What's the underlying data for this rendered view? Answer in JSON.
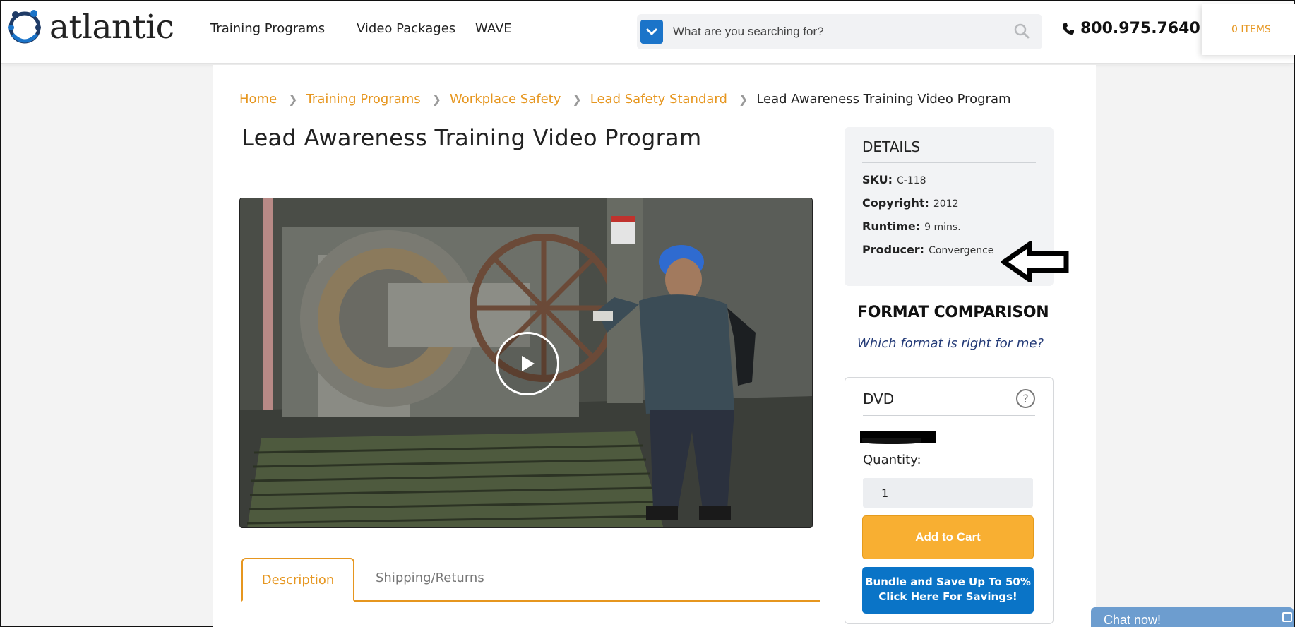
{
  "header": {
    "logo_text": "atlantic",
    "nav": [
      "Training Programs",
      "Video Packages",
      "WAVE"
    ],
    "search_placeholder": "What are you searching for?",
    "phone": "800.975.7640",
    "cart_label": "0 ITEMS"
  },
  "breadcrumb": [
    "Home",
    "Training Programs",
    "Workplace Safety",
    "Lead Safety Standard"
  ],
  "breadcrumb_current": "Lead Awareness Training Video Program",
  "page_title": "Lead Awareness Training Video Program",
  "video": {
    "play_icon": "play-icon"
  },
  "tabs": {
    "active": "Description",
    "other": "Shipping/Returns"
  },
  "details": {
    "title": "DETAILS",
    "rows": [
      {
        "label": "SKU:",
        "value": "C-118"
      },
      {
        "label": "Copyright:",
        "value": "2012"
      },
      {
        "label": "Runtime:",
        "value": "9 mins."
      },
      {
        "label": "Producer:",
        "value": "Convergence"
      }
    ]
  },
  "format": {
    "title": "FORMAT COMPARISON",
    "link": "Which format is right for me?"
  },
  "dvd": {
    "title": "DVD",
    "help": "?",
    "quantity_label": "Quantity:",
    "quantity_value": "1",
    "add_to_cart": "Add to Cart",
    "bundle_line1": "Bundle and Save Up To 50%",
    "bundle_line2": "Click Here For Savings!"
  },
  "chat": {
    "label": "Chat now!"
  },
  "colors": {
    "accent": "#e6961f",
    "blue": "#0a74c7",
    "cart_button": "#f8af32"
  }
}
